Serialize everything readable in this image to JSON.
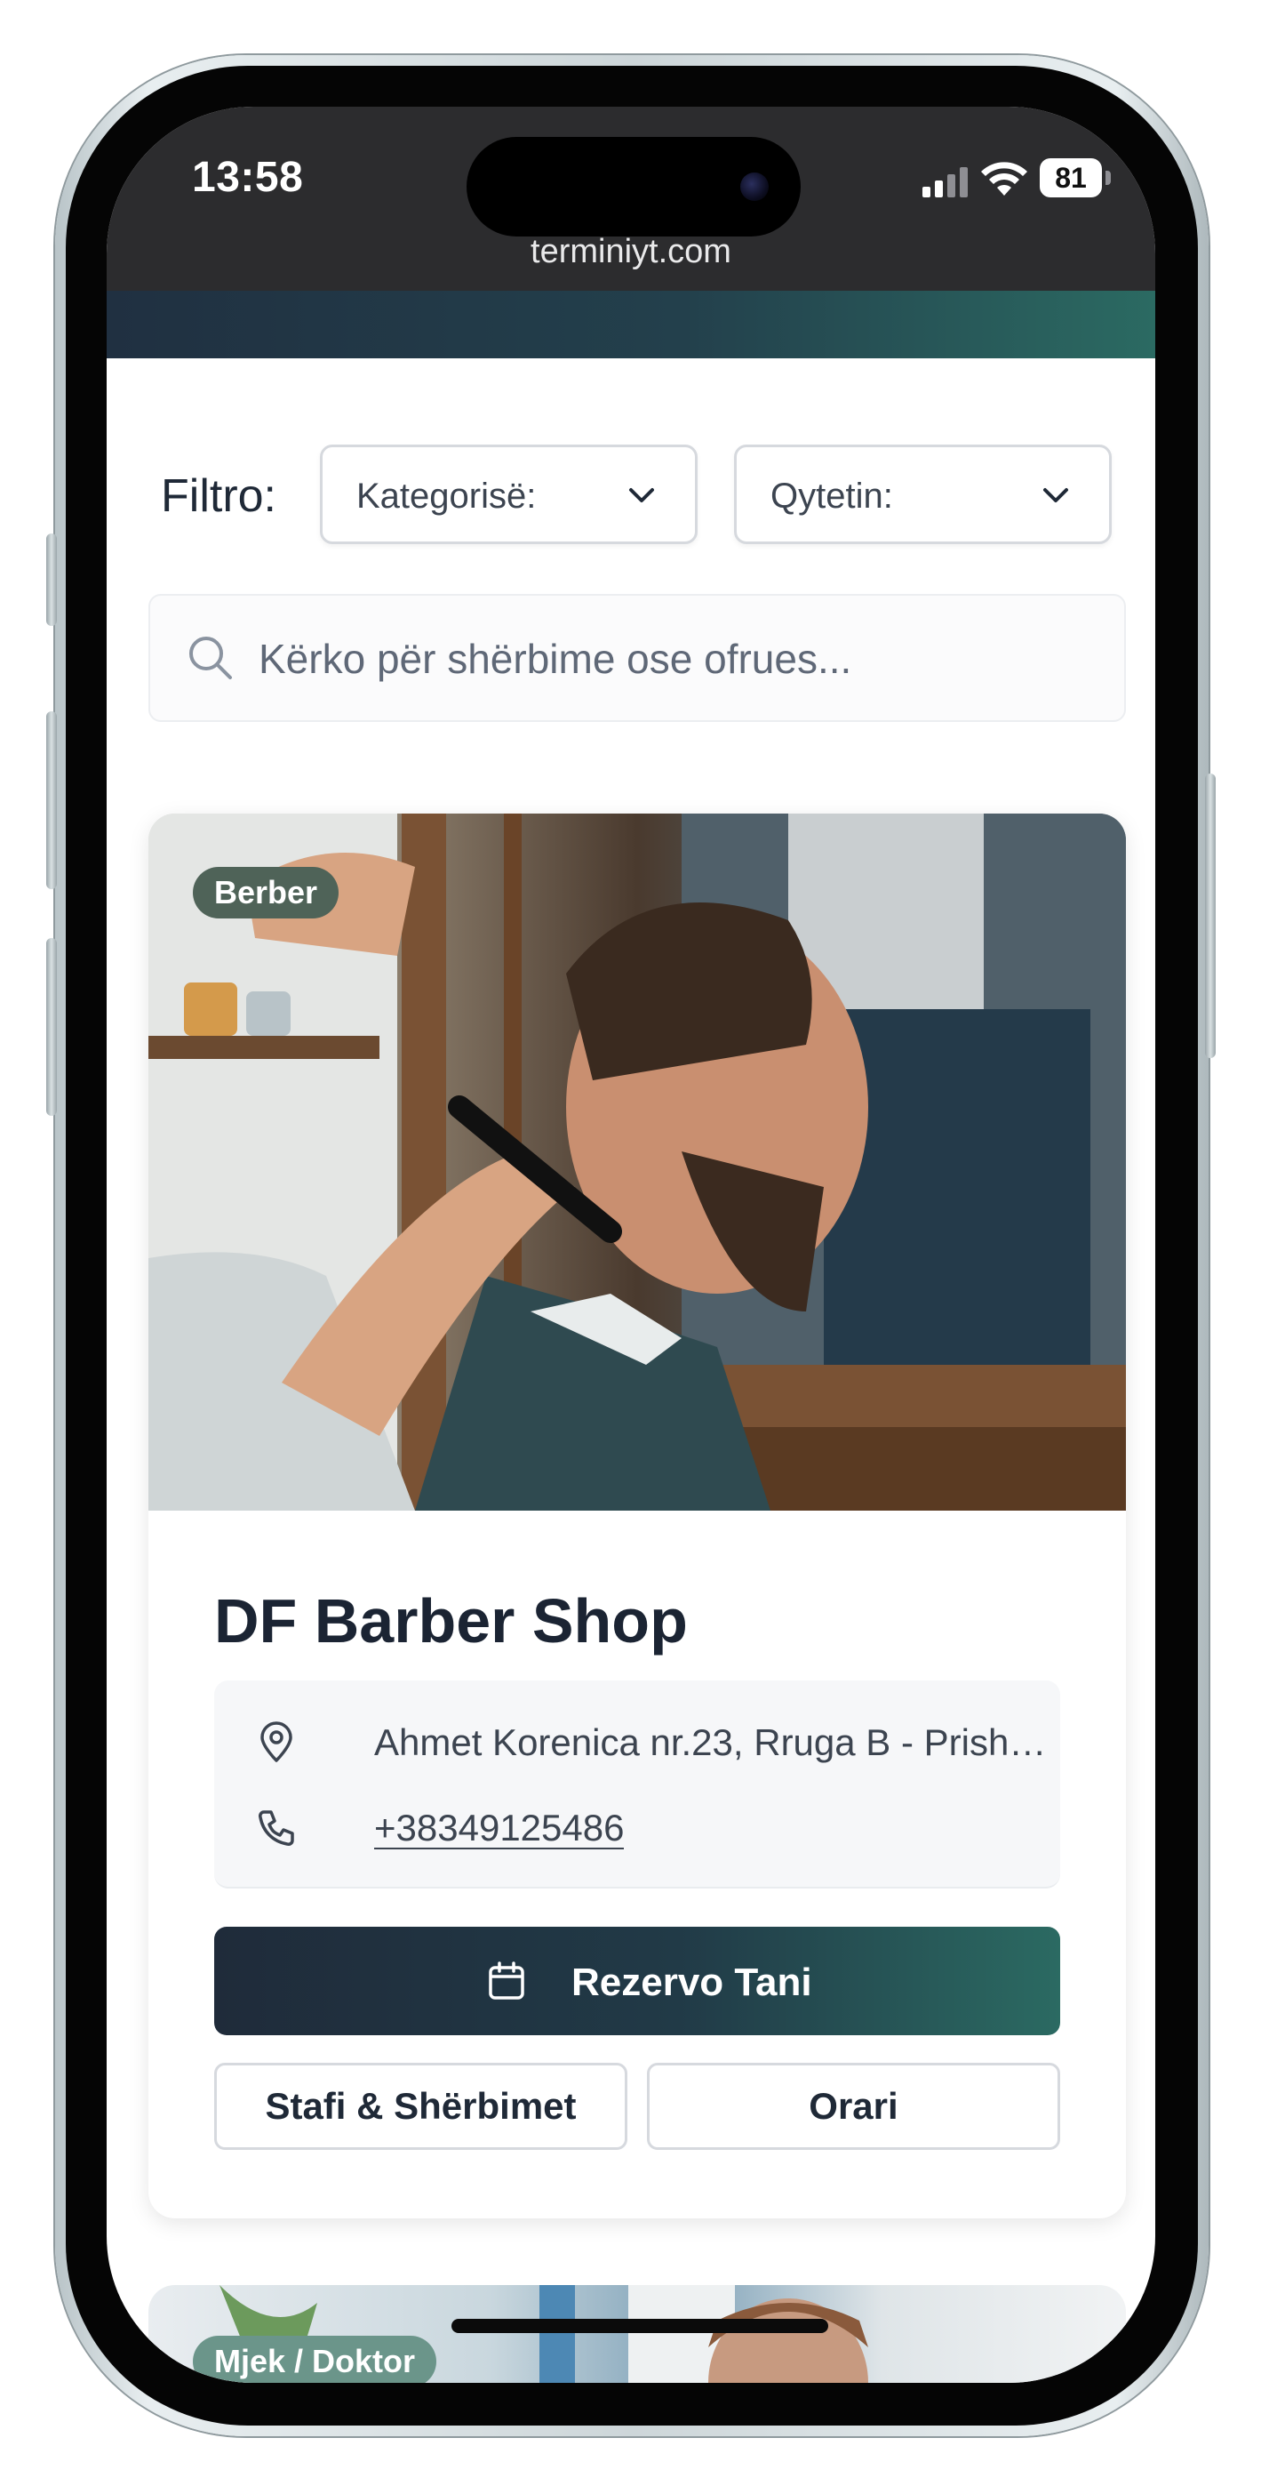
{
  "status_bar": {
    "time": "13:58",
    "battery": "81",
    "url": "terminiyt.com"
  },
  "filters": {
    "label": "Filtro:",
    "category_select": "Kategorisë:",
    "city_select": "Qytetin:"
  },
  "search": {
    "placeholder": "Kërko për shërbime ose ofrues..."
  },
  "cards": [
    {
      "badge": "Berber",
      "title": "DF Barber Shop",
      "address": "Ahmet Korenica nr.23, Rruga B - Prisht...",
      "phone": "+38349125486",
      "reserve_label": "Rezervo Tani",
      "staff_label": "Stafi & Shërbimet",
      "schedule_label": "Orari"
    },
    {
      "badge": "Mjek / Doktor"
    }
  ],
  "colors": {
    "brand_dark": "#1f2b3a",
    "brand_teal": "#2b6a62",
    "badge_dark": "#4f6358",
    "badge_light": "#6b958a"
  },
  "icons": [
    "signal-icon",
    "wifi-icon",
    "chevron-down-icon",
    "search-icon",
    "map-pin-icon",
    "phone-icon",
    "calendar-icon"
  ]
}
